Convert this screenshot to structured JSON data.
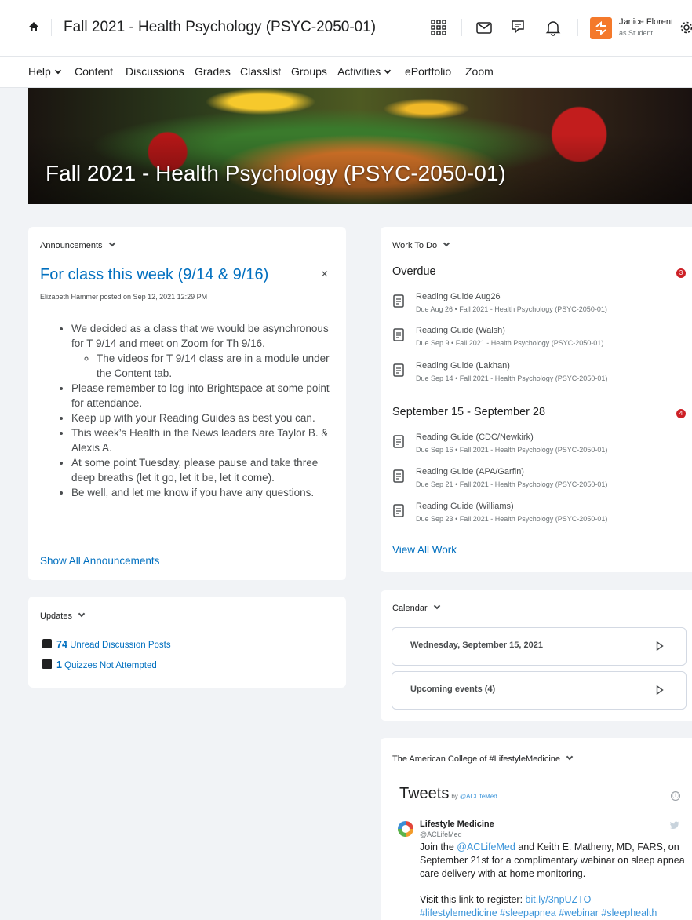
{
  "header": {
    "course_title": "Fall 2021 - Health Psychology (PSYC-2050-01)",
    "user_name": "Janice Florent",
    "user_role": "as Student",
    "icons": [
      "home-icon",
      "waffle-icon",
      "mail-icon",
      "chat-icon",
      "bell-icon",
      "settings-icon"
    ]
  },
  "nav": {
    "items": [
      {
        "label": "Help",
        "dropdown": true
      },
      {
        "label": "Content",
        "dropdown": false
      },
      {
        "label": "Discussions",
        "dropdown": false
      },
      {
        "label": "Grades",
        "dropdown": false
      },
      {
        "label": "Classlist",
        "dropdown": false
      },
      {
        "label": "Groups",
        "dropdown": false
      },
      {
        "label": "Activities",
        "dropdown": true
      },
      {
        "label": "ePortfolio",
        "dropdown": false
      },
      {
        "label": "Zoom",
        "dropdown": false
      }
    ]
  },
  "banner": {
    "title": "Fall 2021 - Health Psychology (PSYC-2050-01)"
  },
  "announcements": {
    "heading": "Announcements",
    "title": "For class this week (9/14 & 9/16)",
    "close": "×",
    "meta": "Elizabeth Hammer posted on Sep 12, 2021 12:29 PM",
    "bullets": [
      "We decided as a class that we would be asynchronous for T 9/14 and meet on Zoom for Th 9/16.",
      "Please remember to log into Brightspace at some point for attendance.",
      "Keep up with your Reading Guides as best you can.",
      "This week’s Health in the News leaders are Taylor B. & Alexis A.",
      "At some point Tuesday, please pause and take three deep breaths (let it go, let it be, let it come).",
      "Be well, and let me know if you have any questions."
    ],
    "sub_bullet": "The videos for T 9/14 class are in a module under the Content tab.",
    "show_all": "Show All Announcements"
  },
  "updates": {
    "heading": "Updates",
    "items": [
      {
        "count": "74",
        "label": "Unread Discussion Posts"
      },
      {
        "count": "1",
        "label": "Quizzes Not Attempted"
      }
    ]
  },
  "work_to_do": {
    "heading": "Work To Do",
    "overdue": {
      "title": "Overdue",
      "badge": "3",
      "items": [
        {
          "title": "Reading Guide Aug26",
          "due": "Due Aug 26",
          "course": "Fall 2021 - Health Psychology (PSYC-2050-01)"
        },
        {
          "title": "Reading Guide (Walsh)",
          "due": "Due Sep 9",
          "course": "Fall 2021 - Health Psychology (PSYC-2050-01)"
        },
        {
          "title": "Reading Guide (Lakhan)",
          "due": "Due Sep 14",
          "course": "Fall 2021 - Health Psychology (PSYC-2050-01)"
        }
      ]
    },
    "upcoming": {
      "title": "September 15 - September 28",
      "badge": "4",
      "items": [
        {
          "title": "Reading Guide (CDC/Newkirk)",
          "due": "Due Sep 16",
          "course": "Fall 2021 - Health Psychology (PSYC-2050-01)"
        },
        {
          "title": "Reading Guide (APA/Garfin)",
          "due": "Due Sep 21",
          "course": "Fall 2021 - Health Psychology (PSYC-2050-01)"
        },
        {
          "title": "Reading Guide (Williams)",
          "due": "Due Sep 23",
          "course": "Fall 2021 - Health Psychology (PSYC-2050-01)"
        }
      ]
    },
    "view_all": "View All Work",
    "separator": "•"
  },
  "calendar": {
    "heading": "Calendar",
    "date_row": "Wednesday, September 15, 2021",
    "events_row": "Upcoming events (4)"
  },
  "twitter": {
    "heading": "The American College of #LifestyleMedicine",
    "tweets_label": "Tweets",
    "by_label": "by",
    "by_handle": "@ACLifeMed",
    "info": "ⓘ",
    "author": "Lifestyle Medicine",
    "handle": "@ACLifeMed",
    "text_pre": "Join the ",
    "text_mention": "@ACLifeMed",
    "text_post": " and Keith E. Matheny, MD, FARS, on September 21st for a complimentary webinar on sleep apnea care delivery with at-home monitoring.",
    "register_label": "Visit this link to register: ",
    "register_link": "bit.ly/3npUZTO",
    "hashtags": "#lifestylemedicine #sleepapnea #webinar #sleephealth"
  },
  "colors": {
    "link": "#006fbf",
    "badge": "#cd2026",
    "avatar": "#f4792b",
    "twitter_blue": "#3b94d9"
  }
}
